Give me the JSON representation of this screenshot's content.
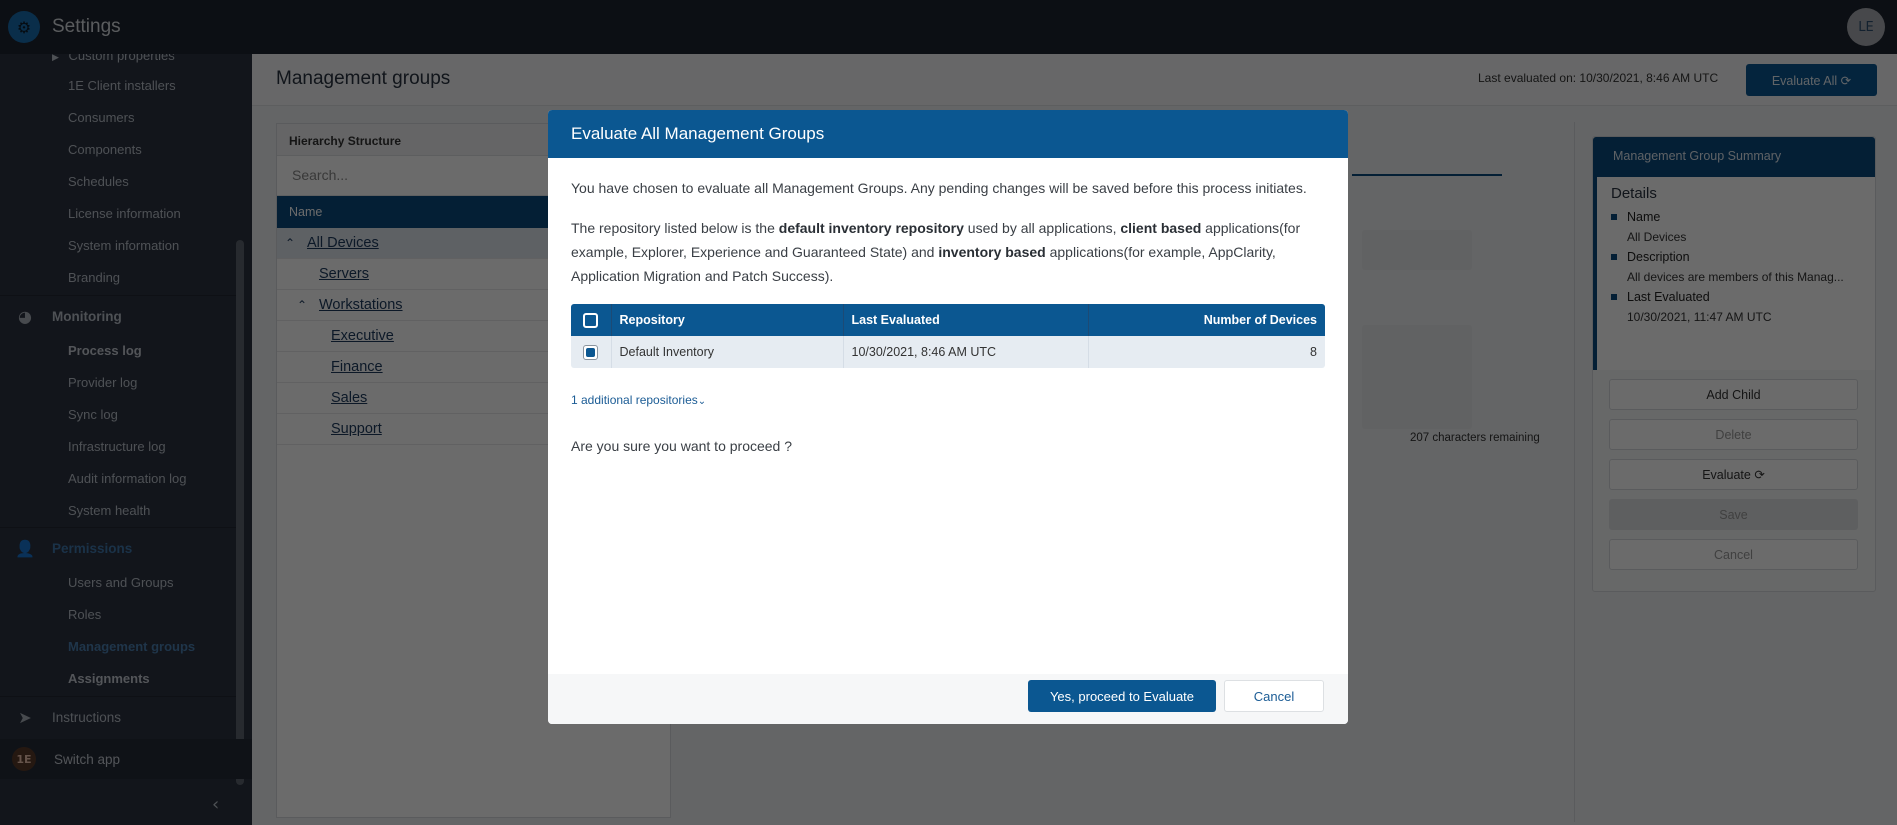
{
  "app": {
    "title": "Settings",
    "logo_icon": "gears-icon",
    "user_initials": "LE"
  },
  "sidebar": {
    "partial_top_item": "Custom properties",
    "settings_items": [
      {
        "label": "1E Client installers"
      },
      {
        "label": "Consumers"
      },
      {
        "label": "Components"
      },
      {
        "label": "Schedules"
      },
      {
        "label": "License information"
      },
      {
        "label": "System information"
      },
      {
        "label": "Branding"
      }
    ],
    "monitoring": {
      "label": "Monitoring",
      "icon": "gauge-icon",
      "items": [
        {
          "label": "Process log"
        },
        {
          "label": "Provider log"
        },
        {
          "label": "Sync log"
        },
        {
          "label": "Infrastructure log"
        },
        {
          "label": "Audit information log"
        },
        {
          "label": "System health"
        }
      ]
    },
    "permissions": {
      "label": "Permissions",
      "icon": "user-gear-icon",
      "items": [
        {
          "label": "Users and Groups"
        },
        {
          "label": "Roles"
        },
        {
          "label": "Management groups",
          "active": true
        },
        {
          "label": "Assignments"
        }
      ]
    },
    "instructions": {
      "label": "Instructions",
      "icon": "paper-plane-icon"
    },
    "switch_app": {
      "label": "Switch app",
      "icon": "1e-logo-icon",
      "icon_text": "1E"
    },
    "collapse_icon": "chevron-left-icon"
  },
  "page": {
    "title": "Management groups",
    "last_evaluated": "Last evaluated on: 10/30/2021, 8:46 AM UTC",
    "evaluate_all_label": "Evaluate All",
    "hierarchy": {
      "title": "Hierarchy Structure",
      "search_placeholder": "Search...",
      "column": "Name",
      "rows": [
        {
          "label": "All Devices",
          "level": 0,
          "expanded": true,
          "selected": true
        },
        {
          "label": "Servers",
          "level": 1
        },
        {
          "label": "Workstations",
          "level": 1,
          "expanded": true
        },
        {
          "label": "Executive",
          "level": 2
        },
        {
          "label": "Finance",
          "level": 2
        },
        {
          "label": "Sales",
          "level": 2
        },
        {
          "label": "Support",
          "level": 2
        }
      ]
    },
    "characters_remaining": "207 characters remaining",
    "summary": {
      "title": "Management Group Summary",
      "details_heading": "Details",
      "fields": [
        {
          "key": "Name",
          "value": "All Devices"
        },
        {
          "key": "Description",
          "value": "All devices are members of this Manag..."
        },
        {
          "key": "Last Evaluated",
          "value": "10/30/2021, 11:47 AM UTC"
        }
      ],
      "buttons": {
        "add_child": "Add Child",
        "delete": "Delete",
        "evaluate": "Evaluate",
        "save": "Save",
        "cancel": "Cancel"
      }
    }
  },
  "modal": {
    "title": "Evaluate All Management Groups",
    "intro": "You have chosen to evaluate all Management Groups. Any pending changes will be saved before this process initiates.",
    "repo_text": {
      "p1": "The repository listed below is the ",
      "b1": "default inventory repository",
      "p2": " used by all applications, ",
      "b2": "client based",
      "p3": " applications(for example, Explorer, Experience and Guaranteed State) and ",
      "b3": "inventory based",
      "p4": " applications(for example, AppClarity, Application Migration and Patch Success)."
    },
    "table": {
      "headers": [
        "Repository",
        "Last Evaluated",
        "Number of Devices"
      ],
      "rows": [
        {
          "checked": true,
          "repository": "Default Inventory",
          "last_evaluated": "10/30/2021, 8:46 AM UTC",
          "devices": "8"
        }
      ]
    },
    "additional_repos": "1 additional repositories",
    "confirm_text": "Are you sure you want to proceed ?",
    "yes_label": "Yes, proceed to Evaluate",
    "cancel_label": "Cancel"
  }
}
